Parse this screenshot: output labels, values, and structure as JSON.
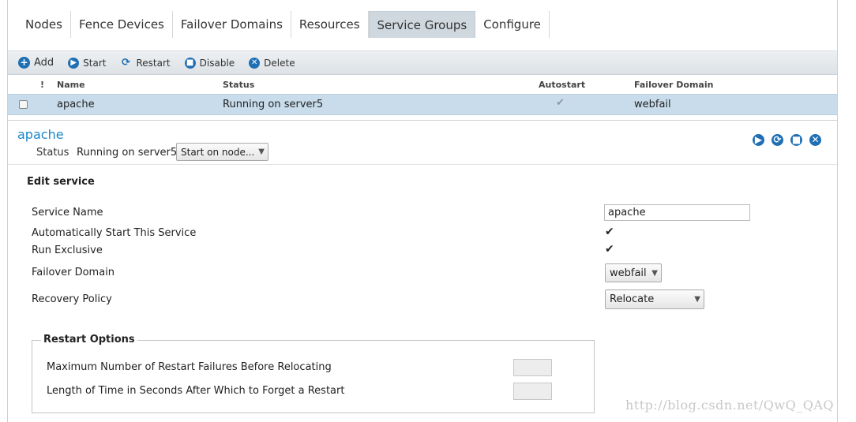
{
  "tabs": [
    "Nodes",
    "Fence Devices",
    "Failover Domains",
    "Resources",
    "Service Groups",
    "Configure"
  ],
  "active_tab": "Service Groups",
  "toolbar": {
    "add": "Add",
    "start": "Start",
    "restart": "Restart",
    "disable": "Disable",
    "delete": "Delete"
  },
  "table": {
    "headers": {
      "flag": "!",
      "name": "Name",
      "status": "Status",
      "autostart": "Autostart",
      "failover_domain": "Failover Domain"
    },
    "rows": [
      {
        "name": "apache",
        "status": "Running on server5",
        "autostart": true,
        "failover_domain": "webfail"
      }
    ]
  },
  "detail": {
    "title": "apache",
    "status_label": "Status",
    "status_value": "Running on server5",
    "start_on_node": "Start on node..."
  },
  "edit": {
    "heading": "Edit service",
    "service_name_label": "Service Name",
    "service_name_value": "apache",
    "autostart_label": "Automatically Start This Service",
    "autostart_checked": true,
    "run_exclusive_label": "Run Exclusive",
    "run_exclusive_checked": true,
    "failover_domain_label": "Failover Domain",
    "failover_domain_value": "webfail",
    "recovery_policy_label": "Recovery Policy",
    "recovery_policy_value": "Relocate"
  },
  "restart_options": {
    "legend": "Restart Options",
    "max_failures_label": "Maximum Number of Restart Failures Before Relocating",
    "forget_after_label": "Length of Time in Seconds After Which to Forget a Restart"
  },
  "icons": {
    "add": "plus-circle-icon",
    "start": "play-circle-icon",
    "restart": "refresh-icon",
    "disable": "stop-circle-icon",
    "delete": "x-circle-icon"
  },
  "colors": {
    "accent": "#1f6fb5",
    "title": "#1d86c7",
    "selected_row": "#c8dceb",
    "active_tab": "#cfd8df"
  },
  "watermark": "http://blog.csdn.net/QwQ_QAQ"
}
